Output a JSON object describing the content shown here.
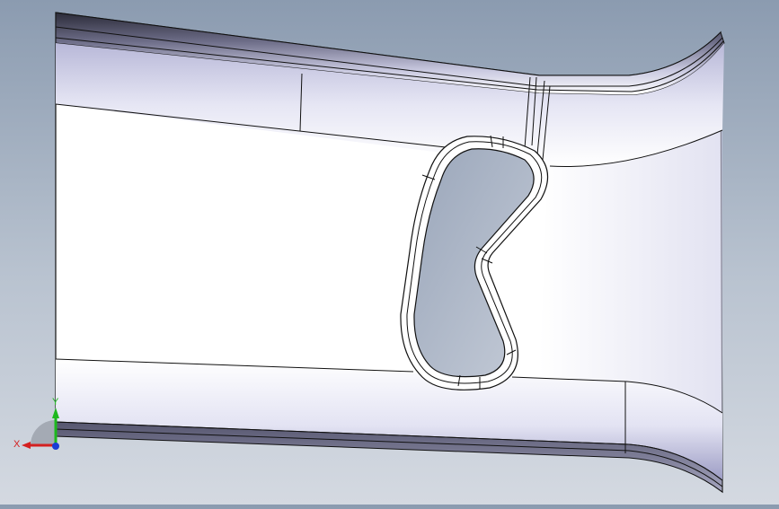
{
  "viewport": {
    "background_top": "#8b9bb0",
    "background_bottom": "#d4d9e1",
    "part_fill": "#ffffff",
    "edge_color": "#1a1a1a",
    "cutout_fill": "#b7c0cf"
  },
  "triad": {
    "x_label": "X",
    "y_label": "Y",
    "x_color": "#d42020",
    "y_color": "#1db81d",
    "z_color": "#1a3cd6"
  }
}
